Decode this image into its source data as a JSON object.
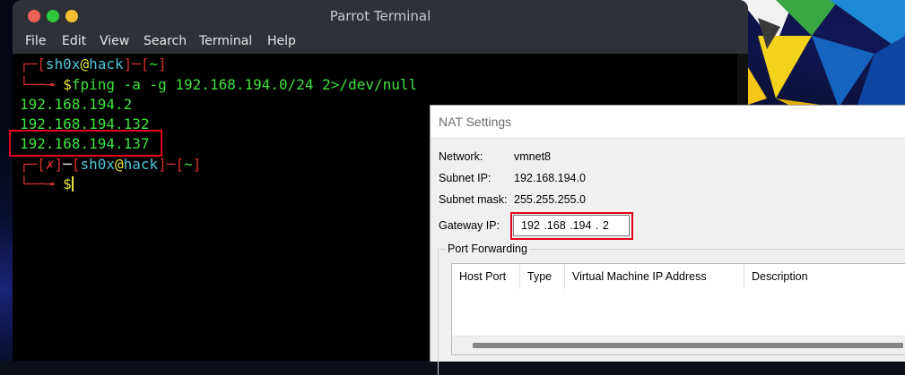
{
  "terminal": {
    "title": "Parrot Terminal",
    "menu": [
      "File",
      "Edit",
      "View",
      "Search",
      "Terminal",
      "Help"
    ],
    "prompt1": {
      "corner": "┌─",
      "bracket_open": "[",
      "user": "sh0x",
      "at": "@",
      "host": "hack",
      "bracket_close": "]",
      "dash": "─",
      "dir_open": "[",
      "dir": "~",
      "dir_close": "]",
      "corner2": "└──╼ ",
      "dollar": "$",
      "command": "fping -a -g 192.168.194.0/24 2>/dev/null"
    },
    "output": [
      "192.168.194.2",
      "192.168.194.132",
      "192.168.194.137"
    ],
    "prompt2": {
      "corner": "┌─",
      "err_open": "[",
      "err": "✗",
      "err_close": "]",
      "dash": "─",
      "bracket_open": "[",
      "user": "sh0x",
      "at": "@",
      "host": "hack",
      "bracket_close": "]",
      "dash2": "─",
      "dir_open": "[",
      "dir": "~",
      "dir_close": "]",
      "corner2": "└──╼ ",
      "dollar": "$"
    }
  },
  "nat": {
    "title": "NAT Settings",
    "network_label": "Network:",
    "network_value": "vmnet8",
    "subnet_ip_label": "Subnet IP:",
    "subnet_ip_value": "192.168.194.0",
    "subnet_mask_label": "Subnet mask:",
    "subnet_mask_value": "255.255.255.0",
    "gateway_label": "Gateway IP:",
    "gateway_value": "192 .168 .194 .  2",
    "port_forwarding_label": "Port Forwarding",
    "columns": [
      "Host Port",
      "Type",
      "Virtual Machine IP Address",
      "Description"
    ]
  },
  "colors": {
    "highlight": "#e0001b",
    "terminal_green": "#3fe13f",
    "prompt_red": "#d32f2f",
    "host_cyan": "#4fc3d8"
  }
}
